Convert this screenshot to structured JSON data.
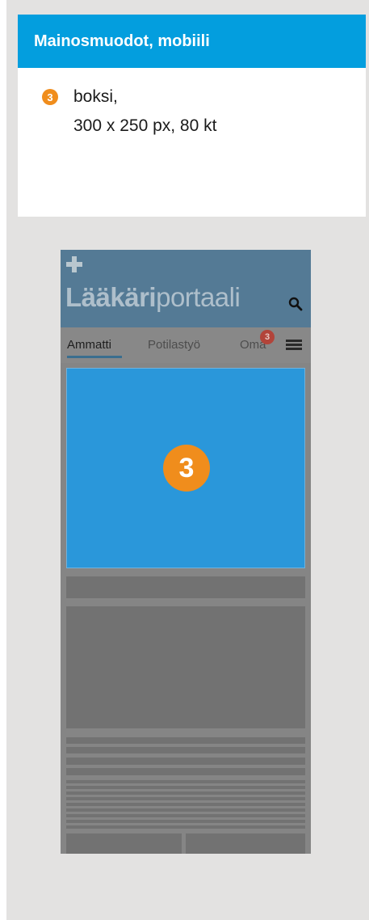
{
  "panel": {
    "title": "Mainosmuodot, mobiili",
    "spec": {
      "badge": "3",
      "line1": "boksi,",
      "line2": "300 x 250 px, 80 kt"
    }
  },
  "phone": {
    "logo_bold": "Lääkäri",
    "logo_light": "portaali",
    "tabs": [
      {
        "label": "Ammatti",
        "active": true
      },
      {
        "label": "Potilastyö",
        "active": false
      },
      {
        "label": "Oma",
        "active": false
      }
    ],
    "tab_badge": "3",
    "ad_badge": "3"
  },
  "colors": {
    "header_blue": "#039ede",
    "badge_orange": "#f08d1c",
    "ad_blue": "#2a97da"
  }
}
